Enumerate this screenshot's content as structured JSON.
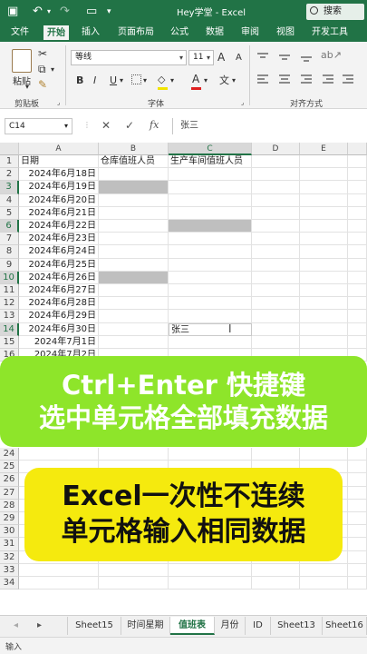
{
  "window": {
    "title": "Hey学堂  -  Excel",
    "search_label": "搜索"
  },
  "ribbon_tabs": [
    "文件",
    "开始",
    "插入",
    "页面布局",
    "公式",
    "数据",
    "审阅",
    "视图",
    "开发工具"
  ],
  "ribbon": {
    "paste_label": "粘贴",
    "clipboard_group": "剪贴板",
    "font_name": "等线",
    "font_size": "11",
    "bold": "B",
    "italic": "I",
    "underline": "U",
    "grow_font": "A",
    "shrink_font": "A",
    "font_color_letter": "A",
    "font_group": "字体",
    "align_group": "对齐方式",
    "accent_color": "#217346",
    "font_color": "#e02020"
  },
  "formula_bar": {
    "name_box": "C14",
    "fx": "fx",
    "cancel": "✕",
    "enter": "✓",
    "content": "张三"
  },
  "grid": {
    "columns": [
      "A",
      "B",
      "C",
      "D",
      "E"
    ],
    "row_numbers": [
      "1",
      "2",
      "3",
      "4",
      "5",
      "6",
      "7",
      "8",
      "9",
      "10",
      "11",
      "12",
      "13",
      "14",
      "15",
      "16",
      "24",
      "25",
      "26",
      "27",
      "28",
      "29",
      "30",
      "31",
      "32",
      "33",
      "34"
    ],
    "headers": {
      "A1": "日期",
      "B1": "仓库值班人员",
      "C1": "生产车间值班人员"
    },
    "dates": [
      "2024年6月18日",
      "2024年6月19日",
      "2024年6月20日",
      "2024年6月21日",
      "2024年6月22日",
      "2024年6月23日",
      "2024年6月24日",
      "2024年6月25日",
      "2024年6月26日",
      "2024年6月27日",
      "2024年6月28日",
      "2024年6月29日",
      "2024年6月30日",
      "2024年7月1日",
      "2024年7月2日"
    ],
    "c14_value": "张三"
  },
  "overlay": {
    "banner1_line1": "Ctrl+Enter 快捷键",
    "banner1_line2": "选中单元格全部填充数据",
    "banner2_line1": "Excel一次性不连续",
    "banner2_line2": "单元格输入相同数据",
    "banner1_color": "#8ee52a",
    "banner2_color": "#f5ea0e"
  },
  "sheet_tabs": [
    "Sheet15",
    "时间星期",
    "值班表",
    "月份",
    "ID",
    "Sheet13",
    "Sheet16"
  ],
  "active_sheet": "值班表",
  "status": {
    "mode": "输入"
  }
}
